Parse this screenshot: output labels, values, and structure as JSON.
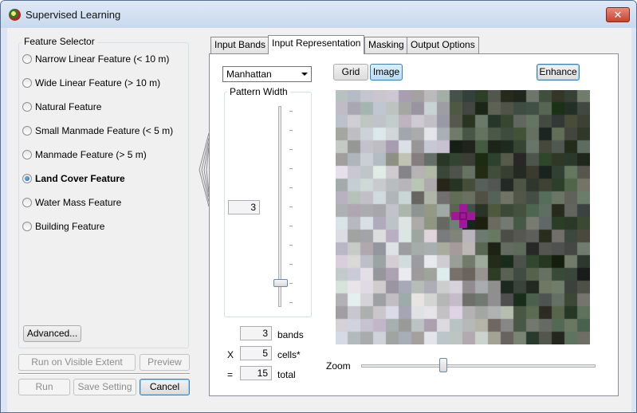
{
  "window": {
    "title": "Supervised Learning",
    "close_glyph": "✕",
    "icon": "app-globe-icon"
  },
  "feature_selector": {
    "legend": "Feature Selector",
    "items": [
      {
        "label": "Narrow Linear Feature (< 10 m)",
        "checked": false
      },
      {
        "label": "Wide Linear Feature (> 10 m)",
        "checked": false
      },
      {
        "label": "Natural Feature",
        "checked": false
      },
      {
        "label": "Small Manmade Feature (< 5 m)",
        "checked": false
      },
      {
        "label": "Manmade Feature (> 5 m)",
        "checked": false
      },
      {
        "label": "Land Cover Feature",
        "checked": true
      },
      {
        "label": "Water Mass Feature",
        "checked": false
      },
      {
        "label": "Building Feature",
        "checked": false
      }
    ],
    "advanced_label": "Advanced..."
  },
  "actions": {
    "run_visible_label": "Run on Visible Extent",
    "preview_label": "Preview",
    "run_label": "Run",
    "save_setting_label": "Save Setting",
    "cancel_label": "Cancel"
  },
  "tabs": [
    {
      "label": "Input Bands",
      "active": false
    },
    {
      "label": "Input Representation",
      "active": true
    },
    {
      "label": "Masking",
      "active": false
    },
    {
      "label": "Output Options",
      "active": false
    }
  ],
  "representation": {
    "pattern_type": "Manhattan",
    "pattern_width_label": "Pattern Width",
    "pattern_width_value": "3",
    "pattern_width_level": 3,
    "bands_value": "3",
    "bands_label": "bands",
    "multiply_sign": "X",
    "cells_value": "5",
    "cells_label": "cells*",
    "equals_sign": "=",
    "total_value": "15",
    "total_label": "total",
    "grid_label": "Grid",
    "image_label": "Image",
    "enhance_label": "Enhance",
    "zoom_label": "Zoom",
    "zoom_level": 0.35,
    "grid_size": 20
  },
  "colors": {
    "accent": "#3c7fb1",
    "cursor_magenta": "#a0189a"
  }
}
